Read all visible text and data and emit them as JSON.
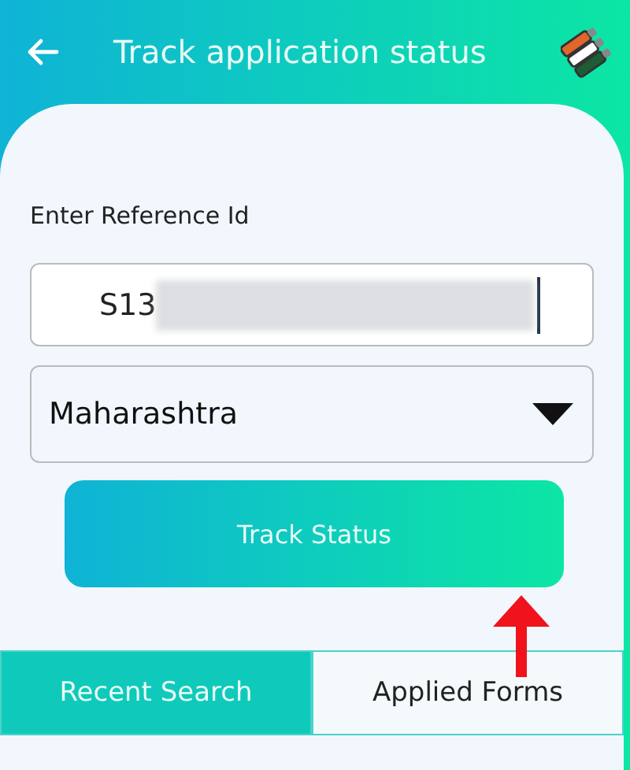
{
  "header": {
    "title": "Track application status"
  },
  "form": {
    "label": "Enter Reference Id",
    "reference": {
      "value": "S13",
      "redacted": true
    },
    "state_select": {
      "value": "Maharashtra"
    },
    "button": "Track Status"
  },
  "tabs": [
    {
      "label": "Recent Search",
      "selected": true
    },
    {
      "label": "Applied Forms",
      "selected": false
    }
  ],
  "annotation": {
    "kind": "arrow"
  }
}
